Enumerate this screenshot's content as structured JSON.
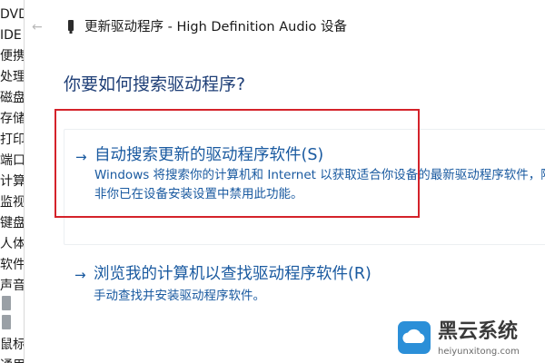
{
  "background_tree": {
    "items": [
      "DVD",
      "IDE",
      "便携",
      "处理",
      "磁盘",
      "存储",
      "打印",
      "端口",
      "计算",
      "监视",
      "键盘",
      "人体",
      "软件",
      "声音",
      "",
      "",
      "鼠标",
      "通用"
    ]
  },
  "dialog": {
    "title": "更新驱动程序 - High Definition Audio 设备",
    "question": "你要如何搜索驱动程序?",
    "options": [
      {
        "arrow": "→",
        "title": "自动搜索更新的驱动程序软件(S)",
        "desc_lines": [
          "Windows 将搜索你的计算机和 Internet 以获取适合你设备的最新驱动程序软件，除",
          "非你已在设备安装设置中禁用此功能。"
        ]
      },
      {
        "arrow": "→",
        "title": "浏览我的计算机以查找驱动程序软件(R)",
        "desc": "手动查找并安装驱动程序软件。"
      }
    ]
  },
  "watermark": {
    "name": "黑云系统",
    "url": "heiyunxitong.com"
  },
  "colors": {
    "link_blue": "#1a5aa0",
    "question_blue": "#1f3f77",
    "highlight_red": "#d4222a"
  }
}
